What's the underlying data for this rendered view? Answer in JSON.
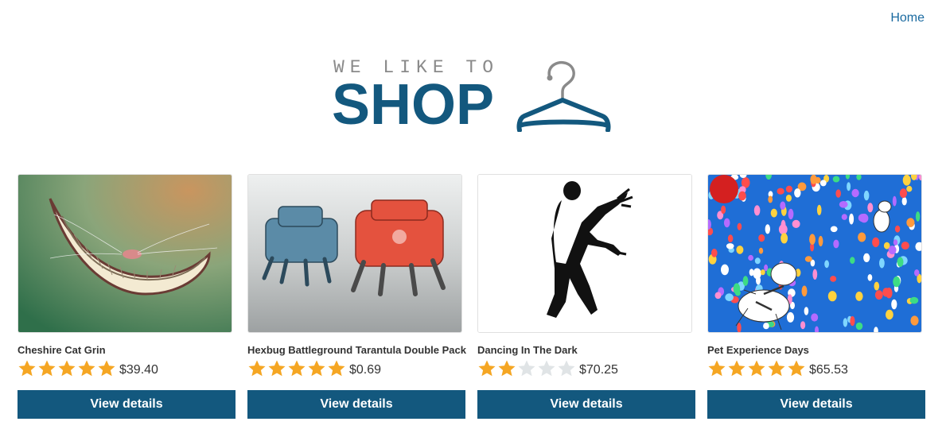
{
  "nav": {
    "home_label": "Home"
  },
  "logo": {
    "tagline": "WE LIKE TO",
    "title": "SHOP",
    "primary_color": "#13587e",
    "tagline_color": "#8a8a8a"
  },
  "colors": {
    "accent": "#13587e",
    "star_filled": "#f5a623",
    "star_empty": "#e0e4e6"
  },
  "products": [
    {
      "name": "Cheshire Cat Grin",
      "rating": 5,
      "max_rating": 5,
      "price": "$39.40",
      "button_label": "View details",
      "image": "cheshire-cat-grin-image"
    },
    {
      "name": "Hexbug Battleground Tarantula Double Pack",
      "rating": 5,
      "max_rating": 5,
      "price": "$0.69",
      "button_label": "View details",
      "image": "hexbug-tarantula-robots-image"
    },
    {
      "name": "Dancing In The Dark",
      "rating": 2,
      "max_rating": 5,
      "price": "$70.25",
      "button_label": "View details",
      "image": "dancing-silhouette-image"
    },
    {
      "name": "Pet Experience Days",
      "rating": 5,
      "max_rating": 5,
      "price": "$65.53",
      "button_label": "View details",
      "image": "dogs-with-balloons-image"
    }
  ]
}
